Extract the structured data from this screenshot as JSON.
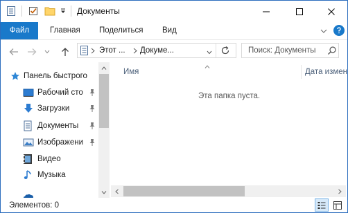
{
  "window": {
    "title": "Документы"
  },
  "ribbon": {
    "tabs": [
      {
        "label": "Файл"
      },
      {
        "label": "Главная"
      },
      {
        "label": "Поделиться"
      },
      {
        "label": "Вид"
      }
    ]
  },
  "address": {
    "segments": [
      "Этот ...",
      "Докуме..."
    ]
  },
  "search": {
    "placeholder": "Поиск: Документы"
  },
  "sidebar": {
    "items": [
      {
        "label": "Панель быстрого",
        "icon": "star-icon",
        "pinned": false
      },
      {
        "label": "Рабочий сто",
        "icon": "desktop-icon",
        "pinned": true
      },
      {
        "label": "Загрузки",
        "icon": "download-icon",
        "pinned": true
      },
      {
        "label": "Документы",
        "icon": "documents-icon",
        "pinned": true
      },
      {
        "label": "Изображени",
        "icon": "pictures-icon",
        "pinned": true
      },
      {
        "label": "Видео",
        "icon": "video-icon",
        "pinned": false
      },
      {
        "label": "Музыка",
        "icon": "music-icon",
        "pinned": false
      }
    ]
  },
  "content": {
    "columns": [
      "Имя",
      "Дата измен"
    ],
    "empty_message": "Эта папка пуста."
  },
  "status": {
    "text": "Элементов: 0"
  },
  "colors": {
    "accent": "#1979ca",
    "border": "#2b6cbd"
  }
}
